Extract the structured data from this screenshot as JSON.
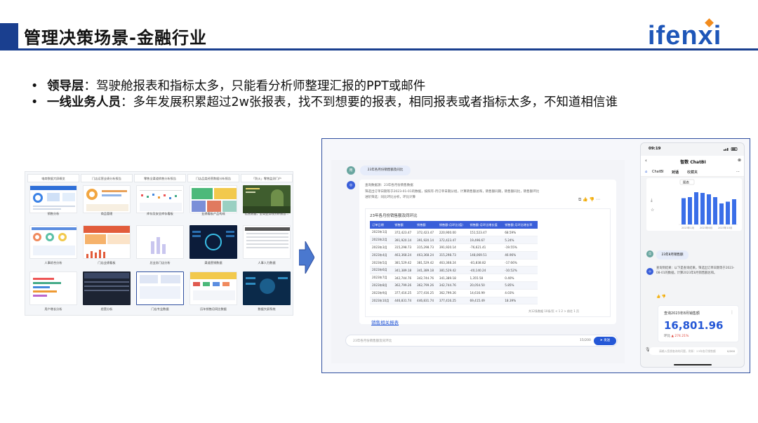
{
  "slide": {
    "title": "管理决策场景-金融行业",
    "brand": "ifenxi"
  },
  "bullets": [
    {
      "term": "领导层",
      "text": "：驾驶舱报表和指标太多，只能看分析师整理汇报的PPT或邮件"
    },
    {
      "term": "一线业务人员",
      "text": "：多年发展积累超过2w张报表，找不到想要的报表，相同报表或者指标太多，不知道相信谁"
    }
  ],
  "thumbnails": {
    "top_titles": [
      "电商数据大屏概览",
      "门店运营业绩分析报告",
      "零售全渠道销售分析报告",
      "门店品类经营数据分析报告",
      "「防火」零售监测门户"
    ],
    "captions": [
      "销售分析",
      "商品管理",
      "库存及安全库存看板",
      "业绩看板产品构成",
      "运营数据，全局业务线分析报告...",
      "人事综合分析",
      "门店业绩看板",
      "总业务门店分析",
      "渠道营销数据",
      "人事人力数据",
      "用户增长分析",
      "经营分析",
      "门店专业数据",
      "历年销售月同比数据",
      "数据大屏系统"
    ]
  },
  "chat": {
    "question": "23年各月份销售额及同比",
    "answer_meta": [
      "查询数据源：23年各月份销售数据",
      "筛选出订单日期等于2023-01-01的数据，按照年-月订单日期分组，计算销售额总和，销售额同期，销售额同比，销售额环比",
      "进阶筛选：同比环比分析，环比计算"
    ],
    "table_title": "23年各月份销售额及同环比",
    "columns": [
      "订单日期",
      "销售额",
      "销售额",
      "销售额-月环比(值)",
      "销售额-月环比增长值",
      "销售额-月环比增长率"
    ],
    "rows": [
      [
        "2023年1月",
        "372,423.47",
        "372,423.47",
        "220,900.00",
        "151,523.47",
        "68.59%"
      ],
      [
        "2023年2月",
        "391,920.14",
        "391,920.14",
        "372,423.47",
        "19,496.67",
        "5.24%"
      ],
      [
        "2023年3月",
        "315,298.73",
        "315,298.73",
        "391,920.14",
        "-76,621.41",
        "-19.55%"
      ],
      [
        "2023年4月",
        "463,368.24",
        "463,368.24",
        "315,298.73",
        "148,069.51",
        "46.96%"
      ],
      [
        "2023年5月",
        "381,529.42",
        "381,529.42",
        "463,368.24",
        "-81,838.82",
        "-17.66%"
      ],
      [
        "2023年6月",
        "341,389.18",
        "341,389.18",
        "381,529.42",
        "-40,140.24",
        "-10.52%"
      ],
      [
        "2023年7月",
        "342,744.76",
        "342,744.76",
        "341,389.18",
        "1,355.58",
        "0.40%"
      ],
      [
        "2023年8月",
        "362,799.26",
        "362,799.26",
        "342,744.76",
        "20,054.50",
        "5.85%"
      ],
      [
        "2023年9月",
        "377,416.25",
        "377,416.25",
        "362,799.26",
        "14,616.99",
        "4.03%"
      ],
      [
        "2023年10月",
        "446,831.74",
        "446,831.74",
        "377,416.25",
        "69,415.49",
        "18.39%"
      ]
    ],
    "pager": "共12条数据   10条/页  <  1  2  >  前往  1  页",
    "related_link": "销售相关报表",
    "input_placeholder": "23年各月份销售额及同环比",
    "input_count": "15/200",
    "send_label": "发送"
  },
  "phone": {
    "time": "09:19",
    "title": "智数 ChatBI",
    "tabs": [
      "ChatBI",
      "对话",
      "收藏夹"
    ],
    "chart_label": "图表",
    "bar_values": [
      0.75,
      0.78,
      0.92,
      0.9,
      0.86,
      0.78,
      0.6,
      0.65,
      0.72
    ],
    "x_labels": [
      "2023年1月",
      "2023年6月",
      "2023年10月"
    ],
    "question": "23年8月销售额",
    "answer": "查询到结果：以下是查询结果。筛选出订单日期等于2023-08-01的数据，计算2023年8月销售额总和。",
    "kpi_title": "查询2023年8月销售额",
    "kpi_value": "16,801.96",
    "kpi_delta_label": "环比",
    "kpi_delta": "▲ 274.21%",
    "input_placeholder": "请输入您想查询的问题，例如：23年各月销售额",
    "input_count": "0/200"
  },
  "colors": {
    "accent": "#1a3f8f",
    "brand": "#1e56b8",
    "brand_dot": "#f28b1c",
    "table_header": "#3a5fd9",
    "link": "#2457d6",
    "up": "#e0453a"
  }
}
